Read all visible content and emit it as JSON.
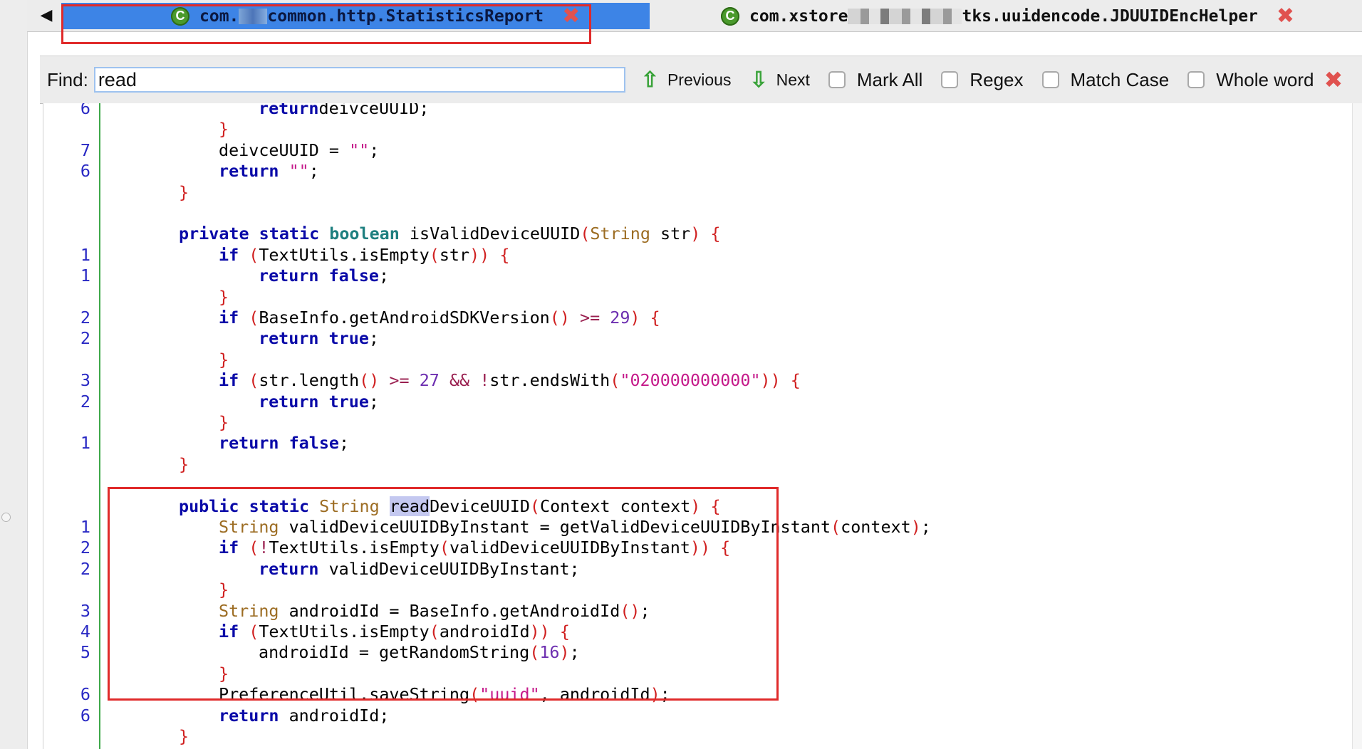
{
  "tabs": [
    {
      "title_start": "com.",
      "title_end": "common.http.StatisticsReport",
      "active": true
    },
    {
      "title_start": "com.xstore",
      "title_end": "tks.uuidencode.JDUUIDEncHelper",
      "active": false
    }
  ],
  "find": {
    "label": "Find:",
    "value": "read",
    "previous_label": "Previous",
    "next_label": "Next",
    "options": [
      "Mark All",
      "Regex",
      "Match Case",
      "Whole word"
    ]
  },
  "code_lines": [
    {
      "ln": "6",
      "indent": 3,
      "tokens": [
        [
          "kw",
          "return"
        ],
        [
          "",
          "deivceUUID;"
        ]
      ]
    },
    {
      "ln": "",
      "indent": 2,
      "tokens": [
        [
          "br",
          "}"
        ]
      ]
    },
    {
      "ln": "7",
      "indent": 2,
      "tokens": [
        [
          "",
          "deivceUUID = "
        ],
        [
          "str",
          "\"\""
        ],
        [
          "",
          ";"
        ]
      ]
    },
    {
      "ln": "6",
      "indent": 2,
      "tokens": [
        [
          "kw",
          "return"
        ],
        [
          "str",
          " \"\""
        ],
        [
          "",
          ";"
        ]
      ]
    },
    {
      "ln": "",
      "indent": 1,
      "tokens": [
        [
          "br",
          "}"
        ]
      ]
    },
    {
      "ln": "",
      "indent": 0,
      "tokens": []
    },
    {
      "ln": "",
      "indent": 1,
      "tokens": [
        [
          "kw",
          "private static "
        ],
        [
          "ty",
          "boolean"
        ],
        [
          "",
          " isValidDeviceUUID"
        ],
        [
          "br",
          "("
        ],
        [
          "cls",
          "String"
        ],
        [
          "",
          " str"
        ],
        [
          "br",
          ")"
        ],
        [
          "br",
          " {"
        ]
      ]
    },
    {
      "ln": "1",
      "indent": 2,
      "tokens": [
        [
          "kw",
          "if"
        ],
        [
          "br",
          " ("
        ],
        [
          "",
          "TextUtils.isEmpty"
        ],
        [
          "br",
          "("
        ],
        [
          "",
          "str"
        ],
        [
          "br",
          ")) {"
        ]
      ]
    },
    {
      "ln": "1",
      "indent": 3,
      "tokens": [
        [
          "kw",
          "return false"
        ],
        [
          "",
          ";"
        ]
      ]
    },
    {
      "ln": "",
      "indent": 2,
      "tokens": [
        [
          "br",
          "}"
        ]
      ]
    },
    {
      "ln": "2",
      "indent": 2,
      "tokens": [
        [
          "kw",
          "if"
        ],
        [
          "br",
          " ("
        ],
        [
          "",
          "BaseInfo.getAndroidSDKVersion"
        ],
        [
          "br",
          "()"
        ],
        [
          "op",
          " >= "
        ],
        [
          "num",
          "29"
        ],
        [
          "br",
          ") {"
        ]
      ]
    },
    {
      "ln": "2",
      "indent": 3,
      "tokens": [
        [
          "kw",
          "return true"
        ],
        [
          "",
          ";"
        ]
      ]
    },
    {
      "ln": "",
      "indent": 2,
      "tokens": [
        [
          "br",
          "}"
        ]
      ]
    },
    {
      "ln": "3",
      "indent": 2,
      "tokens": [
        [
          "kw",
          "if"
        ],
        [
          "br",
          " ("
        ],
        [
          "",
          "str.length"
        ],
        [
          "br",
          "()"
        ],
        [
          "op",
          " >= "
        ],
        [
          "num",
          "27"
        ],
        [
          "op",
          " && !"
        ],
        [
          "",
          "str.endsWith"
        ],
        [
          "br",
          "("
        ],
        [
          "str",
          "\"020000000000\""
        ],
        [
          "br",
          ")) {"
        ]
      ]
    },
    {
      "ln": "2",
      "indent": 3,
      "tokens": [
        [
          "kw",
          "return true"
        ],
        [
          "",
          ";"
        ]
      ]
    },
    {
      "ln": "",
      "indent": 2,
      "tokens": [
        [
          "br",
          "}"
        ]
      ]
    },
    {
      "ln": "1",
      "indent": 2,
      "tokens": [
        [
          "kw",
          "return false"
        ],
        [
          "",
          ";"
        ]
      ]
    },
    {
      "ln": "",
      "indent": 1,
      "tokens": [
        [
          "br",
          "}"
        ]
      ]
    },
    {
      "ln": "",
      "indent": 0,
      "tokens": []
    },
    {
      "ln": "",
      "indent": 1,
      "tokens": [
        [
          "kw",
          "public static "
        ],
        [
          "cls",
          "String"
        ],
        [
          "",
          " "
        ],
        [
          "match",
          "read"
        ],
        [
          "",
          "DeviceUUID"
        ],
        [
          "br",
          "("
        ],
        [
          "",
          "Context context"
        ],
        [
          "br",
          ")"
        ],
        [
          "br",
          " {"
        ]
      ]
    },
    {
      "ln": "1",
      "indent": 2,
      "tokens": [
        [
          "cls",
          "String"
        ],
        [
          "",
          " validDeviceUUIDByInstant = getValidDeviceUUIDByInstant"
        ],
        [
          "br",
          "("
        ],
        [
          "",
          "context"
        ],
        [
          "br",
          ")"
        ],
        [
          "",
          ";"
        ]
      ]
    },
    {
      "ln": "2",
      "indent": 2,
      "tokens": [
        [
          "kw",
          "if"
        ],
        [
          "br",
          " ("
        ],
        [
          "op",
          "!"
        ],
        [
          "",
          "TextUtils.isEmpty"
        ],
        [
          "br",
          "("
        ],
        [
          "",
          "validDeviceUUIDByInstant"
        ],
        [
          "br",
          ")) {"
        ]
      ]
    },
    {
      "ln": "2",
      "indent": 3,
      "tokens": [
        [
          "kw",
          "return"
        ],
        [
          "",
          " validDeviceUUIDByInstant;"
        ]
      ]
    },
    {
      "ln": "",
      "indent": 2,
      "tokens": [
        [
          "br",
          "}"
        ]
      ]
    },
    {
      "ln": "3",
      "indent": 2,
      "tokens": [
        [
          "cls",
          "String"
        ],
        [
          "",
          " androidId = BaseInfo.getAndroidId"
        ],
        [
          "br",
          "()"
        ],
        [
          "",
          ";"
        ]
      ]
    },
    {
      "ln": "4",
      "indent": 2,
      "tokens": [
        [
          "kw",
          "if"
        ],
        [
          "br",
          " ("
        ],
        [
          "",
          "TextUtils.isEmpty"
        ],
        [
          "br",
          "("
        ],
        [
          "",
          "androidId"
        ],
        [
          "br",
          ")) {"
        ]
      ]
    },
    {
      "ln": "5",
      "indent": 3,
      "tokens": [
        [
          "",
          "androidId = getRandomString"
        ],
        [
          "br",
          "("
        ],
        [
          "num",
          "16"
        ],
        [
          "br",
          ")"
        ],
        [
          "",
          ";"
        ]
      ]
    },
    {
      "ln": "",
      "indent": 2,
      "tokens": [
        [
          "br",
          "}"
        ]
      ]
    },
    {
      "ln": "6",
      "indent": 2,
      "tokens": [
        [
          "",
          "PreferenceUtil.saveString"
        ],
        [
          "br",
          "("
        ],
        [
          "str",
          "\"uuid\""
        ],
        [
          "",
          ", androidId"
        ],
        [
          "br",
          ")"
        ],
        [
          "",
          ";"
        ]
      ]
    },
    {
      "ln": "6",
      "indent": 2,
      "tokens": [
        [
          "kw",
          "return"
        ],
        [
          "",
          " androidId;"
        ]
      ]
    },
    {
      "ln": "",
      "indent": 1,
      "tokens": [
        [
          "br",
          "}"
        ]
      ]
    }
  ]
}
